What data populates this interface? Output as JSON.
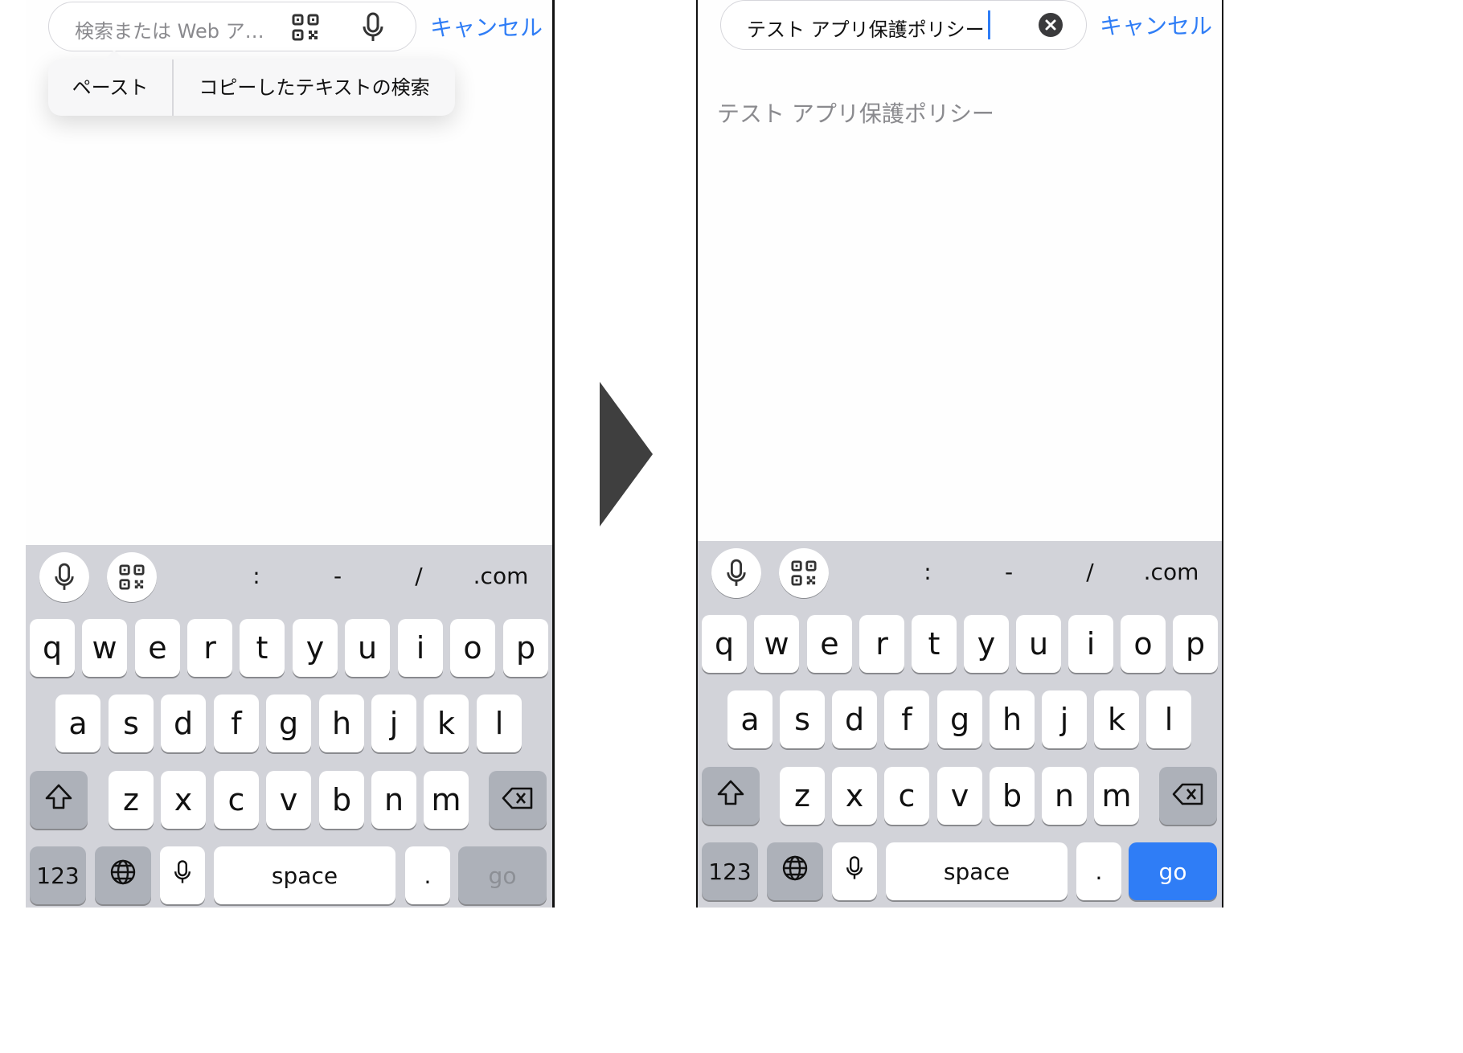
{
  "colors": {
    "accent": "#2f7df6",
    "keyboard_bg": "#d2d3d9",
    "special_key": "#adb1b9",
    "arrow": "#3f3f3f"
  },
  "left": {
    "search_placeholder": "検索または Web ア…",
    "cancel_label": "キャンセル",
    "popup": {
      "paste_label": "ペースト",
      "search_copied_label": "コピーしたテキストの検索"
    },
    "return_label": "go",
    "return_enabled": false
  },
  "right": {
    "search_value": "テスト アプリ保護ポリシー",
    "cancel_label": "キャンセル",
    "suggestion": "テスト アプリ保護ポリシー",
    "return_label": "go",
    "return_enabled": true
  },
  "keyboard": {
    "accessory_chars": [
      ":",
      "-",
      "/",
      ".com"
    ],
    "row1": [
      "q",
      "w",
      "e",
      "r",
      "t",
      "y",
      "u",
      "i",
      "o",
      "p"
    ],
    "row2": [
      "a",
      "s",
      "d",
      "f",
      "g",
      "h",
      "j",
      "k",
      "l"
    ],
    "row3": [
      "z",
      "x",
      "c",
      "v",
      "b",
      "n",
      "m"
    ],
    "numbers_label": "123",
    "space_label": "space",
    "period_label": "."
  },
  "icons": [
    "qr-code-icon",
    "microphone-icon",
    "clear-icon",
    "shift-icon",
    "backspace-icon",
    "globe-icon",
    "forward-arrow-icon"
  ]
}
